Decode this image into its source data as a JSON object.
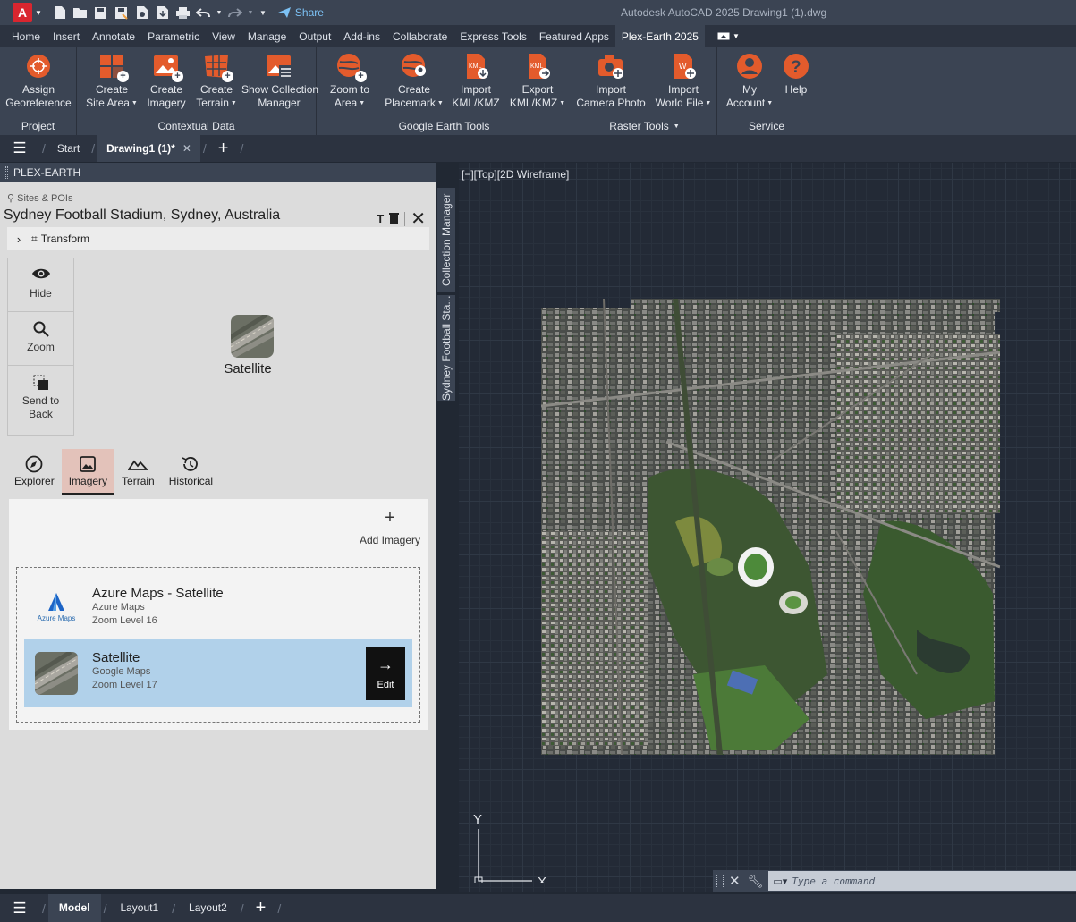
{
  "app": {
    "logo_letter": "A",
    "window_title": "Autodesk AutoCAD 2025    Drawing1 (1).dwg",
    "share_label": "Share"
  },
  "ribbon_tabs": [
    "Home",
    "Insert",
    "Annotate",
    "Parametric",
    "View",
    "Manage",
    "Output",
    "Add-ins",
    "Collaborate",
    "Express Tools",
    "Featured Apps",
    "Plex-Earth 2025"
  ],
  "ribbon": {
    "panels": {
      "project": "Project",
      "contextual": "Contextual Data",
      "google_earth": "Google Earth Tools",
      "raster": "Raster Tools",
      "service": "Service"
    },
    "buttons": {
      "assign_georeference": [
        "Assign",
        "Georeference"
      ],
      "create_site_area": [
        "Create",
        "Site Area"
      ],
      "create_imagery": [
        "Create",
        "Imagery"
      ],
      "create_terrain": [
        "Create",
        "Terrain"
      ],
      "show_collection_manager": [
        "Show Collection",
        "Manager"
      ],
      "zoom_to_area": [
        "Zoom to",
        "Area"
      ],
      "create_placemark": [
        "Create",
        "Placemark"
      ],
      "import_kml": [
        "Import",
        "KML/KMZ"
      ],
      "export_kml": [
        "Export",
        "KML/KMZ"
      ],
      "import_camera_photo": [
        "Import",
        "Camera Photo"
      ],
      "import_world_file": [
        "Import",
        "World File"
      ],
      "my_account": [
        "My",
        "Account"
      ],
      "help": [
        "Help",
        ""
      ]
    }
  },
  "doc_tabs": {
    "start": "Start",
    "drawing": "Drawing1 (1)*"
  },
  "palette": {
    "header": "PLEX-EARTH",
    "breadcrumb": "Sites & POIs",
    "site_title": "Sydney Football Stadium, Sydney, Australia",
    "transform_label": "Transform",
    "tools": {
      "hide": "Hide",
      "zoom": "Zoom",
      "send_to_back": [
        "Send to",
        "Back"
      ]
    },
    "preview_label": "Satellite",
    "icon_tabs": [
      "Explorer",
      "Imagery",
      "Terrain",
      "Historical"
    ],
    "add_imagery": "Add Imagery",
    "imagery_items": [
      {
        "name": "Azure Maps - Satellite",
        "provider": "Azure Maps",
        "zoom": "Zoom Level 16",
        "logo_text": "Azure Maps"
      },
      {
        "name": "Satellite",
        "provider": "Google Maps",
        "zoom": "Zoom Level 17"
      }
    ],
    "edit_label": "Edit"
  },
  "side_tabs": {
    "collection_manager": "Collection Manager",
    "site": "Sydney Football Sta..."
  },
  "viewport": {
    "label": "[−][Top][2D Wireframe]",
    "ucs_y": "Y",
    "ucs_x": "X"
  },
  "command": {
    "placeholder": "Type a command"
  },
  "layout_tabs": [
    "Model",
    "Layout1",
    "Layout2"
  ],
  "colors": {
    "accent": "#e35b2c",
    "selected": "#b1d1ea",
    "active_tab": "#e3c2ba"
  }
}
